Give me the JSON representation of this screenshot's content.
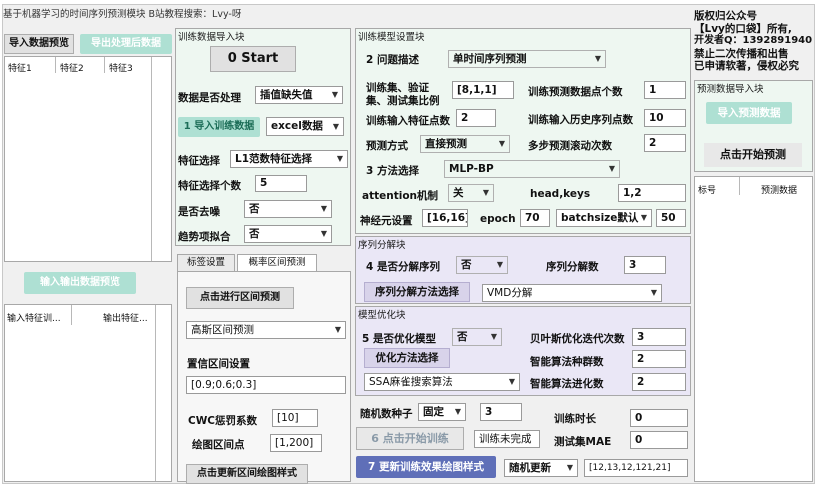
{
  "window_title": "基于机器学习的时间序列预测模块 B站教程搜索：Lvy-呀",
  "left": {
    "import_preview_btn": "导入数据预览",
    "export_preview_btn": "导出处理后数据",
    "table_headers": [
      "特征1",
      "特征2",
      "特征3"
    ],
    "io_preview_btn": "输入输出数据预览",
    "io_table_headers": [
      "输入特征训...",
      "输出特征..."
    ]
  },
  "import_block": {
    "title": "训练数据导入块",
    "start_btn": "0 Start",
    "preprocess_label": "数据是否处理",
    "preprocess_value": "插值缺失值",
    "import_btn": "1 导入训练数据",
    "file_type_value": "excel数据",
    "feature_select_label": "特征选择",
    "feature_select_value": "L1范数特征选择",
    "feature_count_label": "特征选择个数",
    "feature_count_value": "5",
    "denoise_label": "是否去噪",
    "denoise_value": "否",
    "trend_label": "趋势项拟合",
    "trend_value": "否"
  },
  "interval": {
    "tabs": [
      "标签设置",
      "概率区间预测"
    ],
    "run_btn": "点击进行区间预测",
    "method_value": "高斯区间预测",
    "confidence_label": "置信区间设置",
    "confidence_value": "[0.9;0.6;0.3]",
    "cwc_label": "CWC惩罚系数",
    "cwc_value": "[10]",
    "plot_points_label": "绘图区间点",
    "plot_points_value": "[1,200]",
    "update_style_btn": "点击更新区间绘图样式"
  },
  "model_settings": {
    "title": "训练模型设置块",
    "problem_label": "2 问题描述",
    "problem_value": "单时间序列预测",
    "split_label_line1": "训练集、验证",
    "split_label_line2": "集、测试集比例",
    "split_value": "[8,1,1]",
    "pred_points_label": "训练预测数据点个数",
    "pred_points_value": "1",
    "input_features_label": "训练输入特征点数",
    "input_features_value": "2",
    "history_points_label": "训练输入历史序列点数",
    "history_points_value": "10",
    "pred_mode_label": "预测方式",
    "pred_mode_value": "直接预测",
    "rolling_label": "多步预测滚动次数",
    "rolling_value": "2",
    "method_label": "3 方法选择",
    "method_value": "MLP-BP",
    "attention_label": "attention机制",
    "attention_value": "关",
    "headkeys_label": "head,keys",
    "headkeys_value": "1,2",
    "neurons_label": "神经元设置",
    "neurons_value": "[16,16]",
    "epoch_label": "epoch",
    "epoch_value": "70",
    "batchsize_value": "batchsize默认",
    "batchsize_num": "50"
  },
  "decomp": {
    "title": "序列分解块",
    "decompose_label": "4 是否分解序列",
    "decompose_value": "否",
    "decomp_count_label": "序列分解数",
    "decomp_count_value": "3",
    "method_btn": "序列分解方法选择",
    "method_value": "VMD分解"
  },
  "optim": {
    "title": "模型优化块",
    "optimize_label": "5 是否优化模型",
    "optimize_value": "否",
    "bayes_label": "贝叶斯优化迭代次数",
    "bayes_value": "3",
    "method_btn": "优化方法选择",
    "pop_label": "智能算法种群数",
    "pop_value": "2",
    "algo_value": "SSA麻雀搜索算法",
    "iter_label": "智能算法进化数",
    "iter_value": "2"
  },
  "train": {
    "seed_label": "随机数种子",
    "seed_mode": "固定",
    "seed_value": "3",
    "time_label": "训练时长",
    "time_value": "0",
    "start_btn": "6 点击开始训练",
    "status_value": "训练未完成",
    "mae_label": "测试集MAE",
    "mae_value": "0",
    "update_plot_btn": "7 更新训练效果绘图样式",
    "random_update_value": "随机更新",
    "random_list_value": "[12,13,12,121,21]"
  },
  "right": {
    "copyright_lines": [
      "版权归公众号",
      "【Lvy的口袋】所有,",
      "开发者Q：1392891940",
      "禁止二次传播和出售",
      "已申请软著，侵权必究"
    ],
    "pred_block_title": "预测数据导入块",
    "import_pred_btn": "导入预测数据",
    "start_pred_btn": "点击开始预测",
    "table_headers": [
      "标号",
      "预测数据"
    ]
  }
}
